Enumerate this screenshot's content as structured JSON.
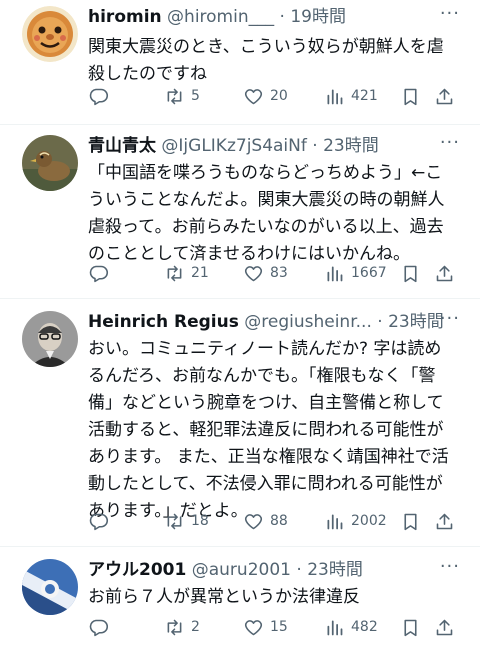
{
  "tweets": [
    {
      "name": "hiromin",
      "handle": "@hiromin___",
      "dot": "·",
      "time": "19時間",
      "text": "関東大震災のとき、こういう奴らが朝鮮人を虐\n殺したのですね",
      "replies": "",
      "retweets": "5",
      "likes": "20",
      "views": "421"
    },
    {
      "name": "青山青太",
      "handle": "@IjGLIKz7jS4aiNf",
      "dot": "·",
      "time": "23時間",
      "text": "「中国語を喋ろうものならどっちめよう」←こ\nういうことなんだよ。関東大震災の時の朝鮮人\n虐殺って。お前らみたいなのがいる以上、過去\nのこととして済ませるわけにはいかんね。",
      "replies": "",
      "retweets": "21",
      "likes": "83",
      "views": "1667"
    },
    {
      "name": "Heinrich Regius",
      "handle": "@regiusheinr...",
      "dot": "·",
      "time": "23時間",
      "text": "おい。コミュニティノート読んだか? 字は読め\nるんだろ、お前なんかでも。「権限もなく「警\n備」などという腕章をつけ、自主警備と称して\n活動すると、軽犯罪法違反に問われる可能性が\nあります。 また、正当な権限なく靖国神社で活\n動したとして、不法侵入罪に問われる可能性が\nあります。」だとよ。",
      "replies": "",
      "retweets": "18",
      "likes": "88",
      "views": "2002"
    },
    {
      "name": "アウル2001",
      "handle": "@auru2001",
      "dot": "·",
      "time": "23時間",
      "text": "お前ら７人が異常というか法律違反",
      "replies": "",
      "retweets": "2",
      "likes": "15",
      "views": "482"
    }
  ],
  "icons": {
    "reply": "reply-icon",
    "retweet": "retweet-icon",
    "like": "heart-icon",
    "views": "views-icon",
    "bookmark": "bookmark-icon",
    "share": "share-icon",
    "more": "more-icon"
  },
  "colors": {
    "text": "#0f1419",
    "secondary": "#536471",
    "divider": "#eff3f4"
  }
}
